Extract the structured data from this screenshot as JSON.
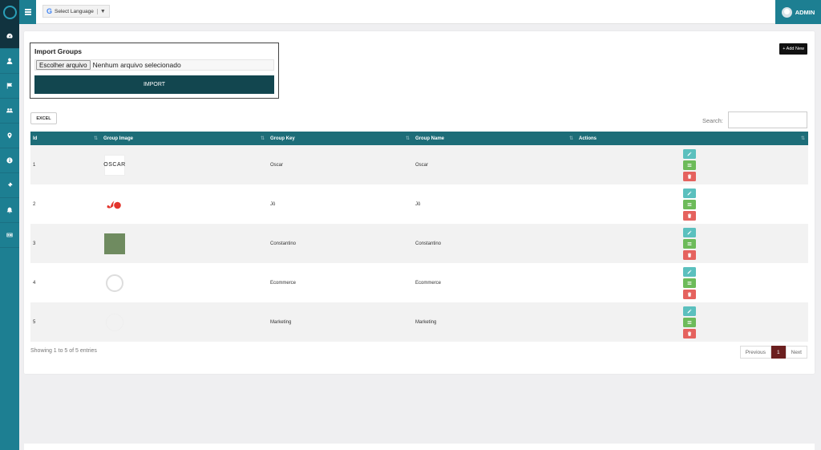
{
  "topbar": {
    "language_label": "Select Language",
    "language_arrow": "▼",
    "google_letter": "G",
    "admin_label": "ADMIN"
  },
  "sidebar": {
    "items": [
      {
        "icon": "dashboard-icon"
      },
      {
        "icon": "user-icon"
      },
      {
        "icon": "flag-icon"
      },
      {
        "icon": "users-icon"
      },
      {
        "icon": "map-marker-icon"
      },
      {
        "icon": "info-icon"
      },
      {
        "icon": "ticket-icon"
      },
      {
        "icon": "bell-icon"
      },
      {
        "icon": "id-card-icon"
      }
    ]
  },
  "import": {
    "title": "Import Groups",
    "file_button": "Escolher arquivo",
    "file_status": "Nenhum arquivo selecionado",
    "submit": "IMPORT"
  },
  "toolbar": {
    "add_new": "+ Add New",
    "excel": "EXCEL",
    "search_label": "Search:",
    "search_value": ""
  },
  "table": {
    "headers": [
      "Id",
      "Group Image",
      "Group Key",
      "Group Name",
      "Actions"
    ],
    "rows": [
      {
        "id": "1",
        "image": "OSCAR",
        "key": "Oscar",
        "name": "Oscar"
      },
      {
        "id": "2",
        "image": "",
        "key": "Jô",
        "name": "Jô"
      },
      {
        "id": "3",
        "image": "",
        "key": "Constantino",
        "name": "Constantino"
      },
      {
        "id": "4",
        "image": "",
        "key": "Ecommerce",
        "name": "Ecommerce"
      },
      {
        "id": "5",
        "image": "",
        "key": "Marketing",
        "name": "Marketing"
      }
    ]
  },
  "footer": {
    "showing": "Showing 1 to 5 of 5 entries",
    "previous": "Previous",
    "current_page": "1",
    "next": "Next"
  },
  "colors": {
    "sidebar": "#1d7f92",
    "header_dark": "#11333f",
    "table_header": "#1d6d78",
    "import_button": "#12464f",
    "edit": "#5bc0be",
    "view": "#6dbb5a",
    "delete": "#e5625e",
    "page_active": "#6b1f1f"
  }
}
